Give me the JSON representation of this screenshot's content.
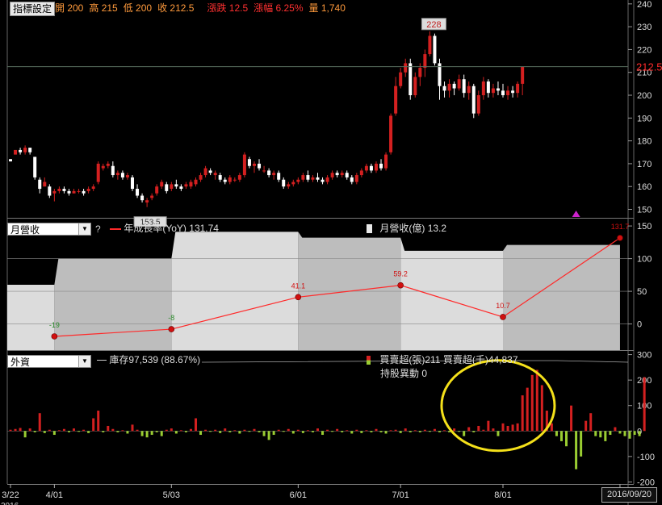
{
  "toolbar": {
    "indicator_button": "指標設定",
    "quote": [
      {
        "label": "開",
        "value": "200",
        "color": "#ff9a3c"
      },
      {
        "label": "高",
        "value": "215",
        "color": "#ff9a3c"
      },
      {
        "label": "低",
        "value": "200",
        "color": "#ff9a3c"
      },
      {
        "label": "收",
        "value": "212.5",
        "color": "#ff9a3c"
      },
      {
        "label": "漲跌",
        "value": "12.5",
        "color": "#ff3030"
      },
      {
        "label": "漲幅",
        "value": "6.25%",
        "color": "#ff3030"
      },
      {
        "label": "量",
        "value": "1,740",
        "color": "#ff9a3c"
      }
    ]
  },
  "colors": {
    "up": "#d42020",
    "down": "#ffffff",
    "line": "#ff2a2a",
    "net_buy": "#d42020",
    "net_sell": "#9acd32",
    "highlight": "#f4e01a",
    "marker": "#cc22cc"
  },
  "chart_data": [
    {
      "type": "candlestick",
      "yticks": [
        150,
        160,
        170,
        180,
        190,
        200,
        210,
        220,
        230,
        240
      ],
      "ylim": [
        147,
        241
      ],
      "last_price_label": "212.5",
      "high_label": "228",
      "low_label": "153.5",
      "candles": [
        [
          172,
          172,
          171,
          171
        ],
        [
          174,
          176,
          174,
          176
        ],
        [
          176,
          177,
          174,
          175
        ],
        [
          175,
          178,
          174,
          177
        ],
        [
          177,
          177,
          174,
          175
        ],
        [
          173,
          173,
          163,
          164
        ],
        [
          163,
          164,
          157,
          159
        ],
        [
          160,
          164,
          160,
          162
        ],
        [
          160,
          161,
          155,
          156
        ],
        [
          157,
          159,
          153.5,
          158
        ],
        [
          158,
          160,
          157,
          159
        ],
        [
          159,
          160,
          157,
          158
        ],
        [
          158,
          159,
          156,
          157
        ],
        [
          157,
          159,
          157,
          158
        ],
        [
          158,
          159,
          157,
          158
        ],
        [
          158,
          159,
          156,
          157
        ],
        [
          158,
          160,
          157,
          159
        ],
        [
          159,
          161,
          158,
          160
        ],
        [
          162,
          171,
          161,
          170
        ],
        [
          168,
          170,
          167,
          169
        ],
        [
          169,
          171,
          168,
          170
        ],
        [
          169,
          171,
          164,
          165
        ],
        [
          165,
          167,
          163,
          166
        ],
        [
          166,
          167,
          163,
          164
        ],
        [
          164,
          166,
          163,
          165
        ],
        [
          164,
          165,
          158,
          159
        ],
        [
          159,
          161,
          155,
          156
        ],
        [
          156,
          157,
          153,
          154
        ],
        [
          153,
          155,
          151,
          154
        ],
        [
          155,
          157,
          154,
          156
        ],
        [
          157,
          161,
          156,
          160
        ],
        [
          160,
          163,
          159,
          162
        ],
        [
          161,
          162,
          157,
          158
        ],
        [
          159,
          162,
          158,
          161
        ],
        [
          161,
          163,
          159,
          160
        ],
        [
          160,
          161,
          158,
          159
        ],
        [
          160,
          162,
          159,
          161
        ],
        [
          160,
          163,
          159,
          162
        ],
        [
          161,
          164,
          160,
          163
        ],
        [
          163,
          166,
          162,
          165
        ],
        [
          165,
          169,
          164,
          168
        ],
        [
          167,
          168,
          165,
          166
        ],
        [
          165,
          167,
          163,
          166
        ],
        [
          165,
          166,
          162,
          163
        ],
        [
          163,
          164,
          161,
          162
        ],
        [
          162,
          165,
          161,
          164
        ],
        [
          163,
          164,
          162,
          163
        ],
        [
          163,
          166,
          162,
          165
        ],
        [
          165,
          175,
          164,
          174
        ],
        [
          172,
          173,
          168,
          169
        ],
        [
          169,
          171,
          166,
          170
        ],
        [
          170,
          172,
          167,
          168
        ],
        [
          167,
          169,
          166,
          167
        ],
        [
          167,
          168,
          164,
          165
        ],
        [
          165,
          167,
          163,
          166
        ],
        [
          166,
          167,
          162,
          163
        ],
        [
          163,
          164,
          159,
          160
        ],
        [
          160,
          162,
          159,
          161
        ],
        [
          161,
          163,
          160,
          162
        ],
        [
          162,
          164,
          161,
          163
        ],
        [
          163,
          166,
          162,
          165
        ],
        [
          165,
          167,
          162,
          163
        ],
        [
          163,
          165,
          162,
          164
        ],
        [
          164,
          166,
          162,
          163
        ],
        [
          163,
          164,
          161,
          162
        ],
        [
          162,
          165,
          161,
          164
        ],
        [
          164,
          167,
          163,
          166
        ],
        [
          166,
          167,
          164,
          165
        ],
        [
          165,
          167,
          164,
          166
        ],
        [
          166,
          167,
          163,
          164
        ],
        [
          164,
          165,
          161,
          162
        ],
        [
          162,
          166,
          161,
          165
        ],
        [
          165,
          168,
          164,
          167
        ],
        [
          167,
          170,
          166,
          169
        ],
        [
          169,
          170,
          166,
          167
        ],
        [
          167,
          171,
          166,
          170
        ],
        [
          170,
          172,
          167,
          168
        ],
        [
          168,
          175,
          167,
          174
        ],
        [
          175,
          192,
          174,
          191
        ],
        [
          192,
          208,
          191,
          204
        ],
        [
          204,
          212,
          203,
          210
        ],
        [
          210,
          216,
          208,
          214
        ],
        [
          214,
          216,
          198,
          200
        ],
        [
          200,
          210,
          199,
          208
        ],
        [
          208,
          214,
          204,
          212
        ],
        [
          212,
          220,
          208,
          218
        ],
        [
          218,
          228,
          217,
          226
        ],
        [
          226,
          227,
          213,
          214
        ],
        [
          214,
          216,
          198,
          204
        ],
        [
          204,
          206,
          199,
          202
        ],
        [
          202,
          207,
          199,
          205
        ],
        [
          205,
          206,
          200,
          203
        ],
        [
          203,
          209,
          202,
          207
        ],
        [
          207,
          209,
          199,
          201
        ],
        [
          201,
          206,
          198,
          204
        ],
        [
          204,
          205,
          190,
          192
        ],
        [
          192,
          202,
          191,
          200
        ],
        [
          200,
          208,
          198,
          206
        ],
        [
          206,
          207,
          199,
          201
        ],
        [
          201,
          205,
          199,
          203
        ],
        [
          203,
          206,
          200,
          202
        ],
        [
          202,
          205,
          199,
          200
        ],
        [
          200,
          204,
          198,
          202
        ],
        [
          202,
          204,
          199,
          201
        ],
        [
          201,
          206,
          199,
          205
        ],
        [
          205,
          206,
          200,
          212.5
        ]
      ]
    },
    {
      "type": "line_bar",
      "selector": "月營收",
      "yoy_label": "年成長率(YoY)",
      "yoy_value": "131.74",
      "revenue_label": "月營收(億)",
      "revenue_value": "13.2",
      "yticks": [
        0,
        50,
        100,
        150
      ],
      "ylim": [
        -40,
        160
      ],
      "revenue_steps": [
        {
          "from": 0,
          "to": 9,
          "value": 60
        },
        {
          "from": 9,
          "to": 33,
          "value": 100
        },
        {
          "from": 33,
          "to": 59,
          "value": 141
        },
        {
          "from": 59,
          "to": 80,
          "value": 132
        },
        {
          "from": 80,
          "to": 101,
          "value": 112
        },
        {
          "from": 101,
          "to": 125,
          "value": 121
        }
      ],
      "yoy_points": [
        {
          "i": 9,
          "value": -19,
          "label": "-19"
        },
        {
          "i": 33,
          "value": -8,
          "label": "-8"
        },
        {
          "i": 59,
          "value": 41.1,
          "label": "41.1"
        },
        {
          "i": 80,
          "value": 59.2,
          "label": "59.2"
        },
        {
          "i": 101,
          "value": 10.7,
          "label": "10.7"
        },
        {
          "i": 125,
          "value": 131.7,
          "label": "131.7"
        }
      ]
    },
    {
      "type": "bar",
      "selector": "外資",
      "inventory_label": "庫存",
      "inventory_value": "97,539 (88.67%)",
      "net_lots_label": "買賣超(張)",
      "net_lots_value": "211",
      "net_amount_label": "買賣超(千)",
      "net_amount_value": "44,837",
      "holding_change_label": "持股異動",
      "holding_change_value": "0",
      "yticks": [
        -200,
        -100,
        0,
        100,
        200,
        300
      ],
      "ylim": [
        -205,
        305
      ],
      "values": [
        5,
        8,
        12,
        -25,
        10,
        -5,
        70,
        -8,
        5,
        -15,
        3,
        8,
        -5,
        10,
        -3,
        5,
        -8,
        50,
        80,
        -5,
        20,
        8,
        -5,
        3,
        -10,
        25,
        5,
        -20,
        -25,
        -15,
        -5,
        -20,
        5,
        10,
        -10,
        3,
        -5,
        8,
        50,
        -15,
        5,
        -3,
        5,
        -8,
        10,
        -5,
        3,
        -10,
        5,
        -3,
        8,
        -5,
        -20,
        -35,
        -15,
        5,
        -3,
        8,
        -10,
        5,
        -8,
        3,
        -5,
        10,
        -15,
        5,
        -3,
        8,
        -5,
        3,
        -10,
        5,
        -8,
        3,
        -5,
        8,
        -5,
        -10,
        3,
        5,
        -8,
        10,
        -5,
        3,
        -5,
        5,
        -3,
        8,
        -5,
        3,
        -5,
        10,
        -3,
        -20,
        15,
        -5,
        20,
        5,
        40,
        10,
        -20,
        30,
        20,
        25,
        30,
        140,
        170,
        220,
        240,
        180,
        80,
        30,
        -20,
        -40,
        -60,
        100,
        -150,
        -100,
        40,
        70,
        -20,
        -25,
        -40,
        -15,
        15,
        -10,
        -20,
        -30,
        -15,
        -20,
        211
      ],
      "highlight": {
        "cx": 100,
        "cy": 100
      }
    }
  ],
  "xaxis": {
    "ticks": [
      {
        "i": 0,
        "label": "3/22"
      },
      {
        "i": 9,
        "label": "4/01"
      },
      {
        "i": 33,
        "label": "5/03"
      },
      {
        "i": 59,
        "label": "6/01"
      },
      {
        "i": 80,
        "label": "7/01"
      },
      {
        "i": 101,
        "label": "8/01"
      },
      {
        "i": 125,
        "label": "9/01"
      }
    ],
    "year_label": "2016",
    "date_readout": "2016/09/20"
  }
}
